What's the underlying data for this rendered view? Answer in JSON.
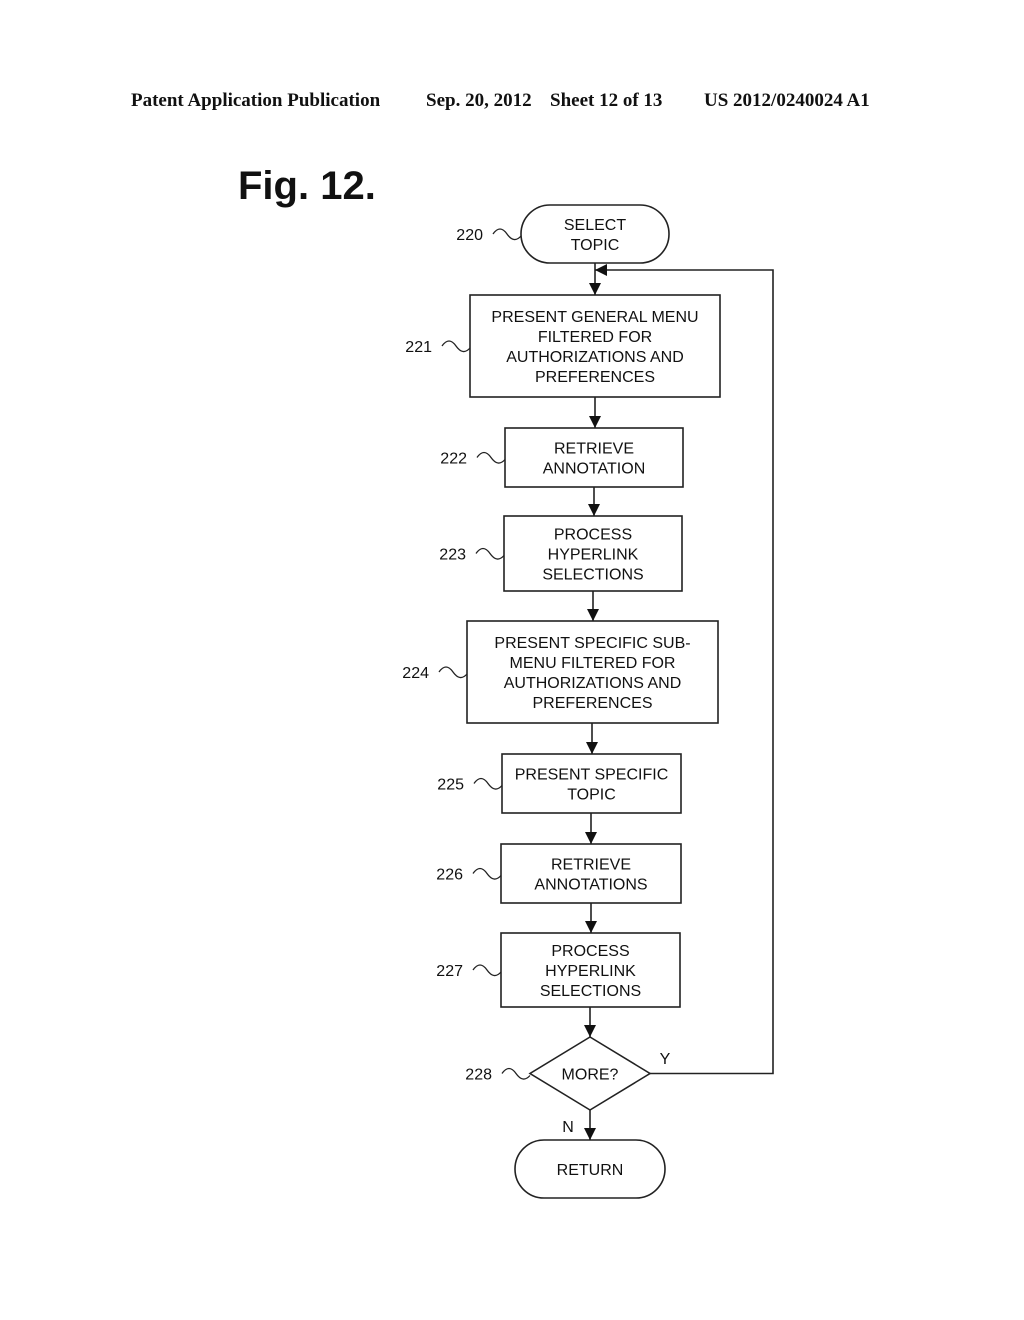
{
  "header": {
    "left": "Patent Application Publication",
    "date": "Sep. 20, 2012",
    "sheet": "Sheet 12 of 13",
    "pub_number": "US 2012/0240024 A1"
  },
  "figure": {
    "title": "Fig. 12.",
    "nodes": [
      {
        "id": "220",
        "type": "terminal",
        "lines": [
          "SELECT",
          "TOPIC"
        ]
      },
      {
        "id": "221",
        "type": "process",
        "lines": [
          "PRESENT GENERAL MENU",
          "FILTERED FOR",
          "AUTHORIZATIONS AND",
          "PREFERENCES"
        ]
      },
      {
        "id": "222",
        "type": "process",
        "lines": [
          "RETRIEVE",
          "ANNOTATION"
        ]
      },
      {
        "id": "223",
        "type": "process",
        "lines": [
          "PROCESS",
          "HYPERLINK",
          "SELECTIONS"
        ]
      },
      {
        "id": "224",
        "type": "process",
        "lines": [
          "PRESENT SPECIFIC SUB-",
          "MENU FILTERED FOR",
          "AUTHORIZATIONS AND",
          "PREFERENCES"
        ]
      },
      {
        "id": "225",
        "type": "process",
        "lines": [
          "PRESENT SPECIFIC",
          "TOPIC"
        ]
      },
      {
        "id": "226",
        "type": "process",
        "lines": [
          "RETRIEVE",
          "ANNOTATIONS"
        ]
      },
      {
        "id": "227",
        "type": "process",
        "lines": [
          "PROCESS",
          "HYPERLINK",
          "SELECTIONS"
        ]
      },
      {
        "id": "228",
        "type": "decision",
        "lines": [
          "MORE?"
        ]
      },
      {
        "id": "",
        "type": "terminal",
        "lines": [
          "RETURN"
        ]
      }
    ],
    "edges": [
      {
        "from": "220",
        "to": "221"
      },
      {
        "from": "221",
        "to": "222"
      },
      {
        "from": "222",
        "to": "223"
      },
      {
        "from": "223",
        "to": "224"
      },
      {
        "from": "224",
        "to": "225"
      },
      {
        "from": "225",
        "to": "226"
      },
      {
        "from": "226",
        "to": "227"
      },
      {
        "from": "227",
        "to": "228"
      },
      {
        "from": "228",
        "to": "221",
        "label": "Y"
      },
      {
        "from": "228",
        "to": "RETURN",
        "label": "N"
      }
    ]
  }
}
